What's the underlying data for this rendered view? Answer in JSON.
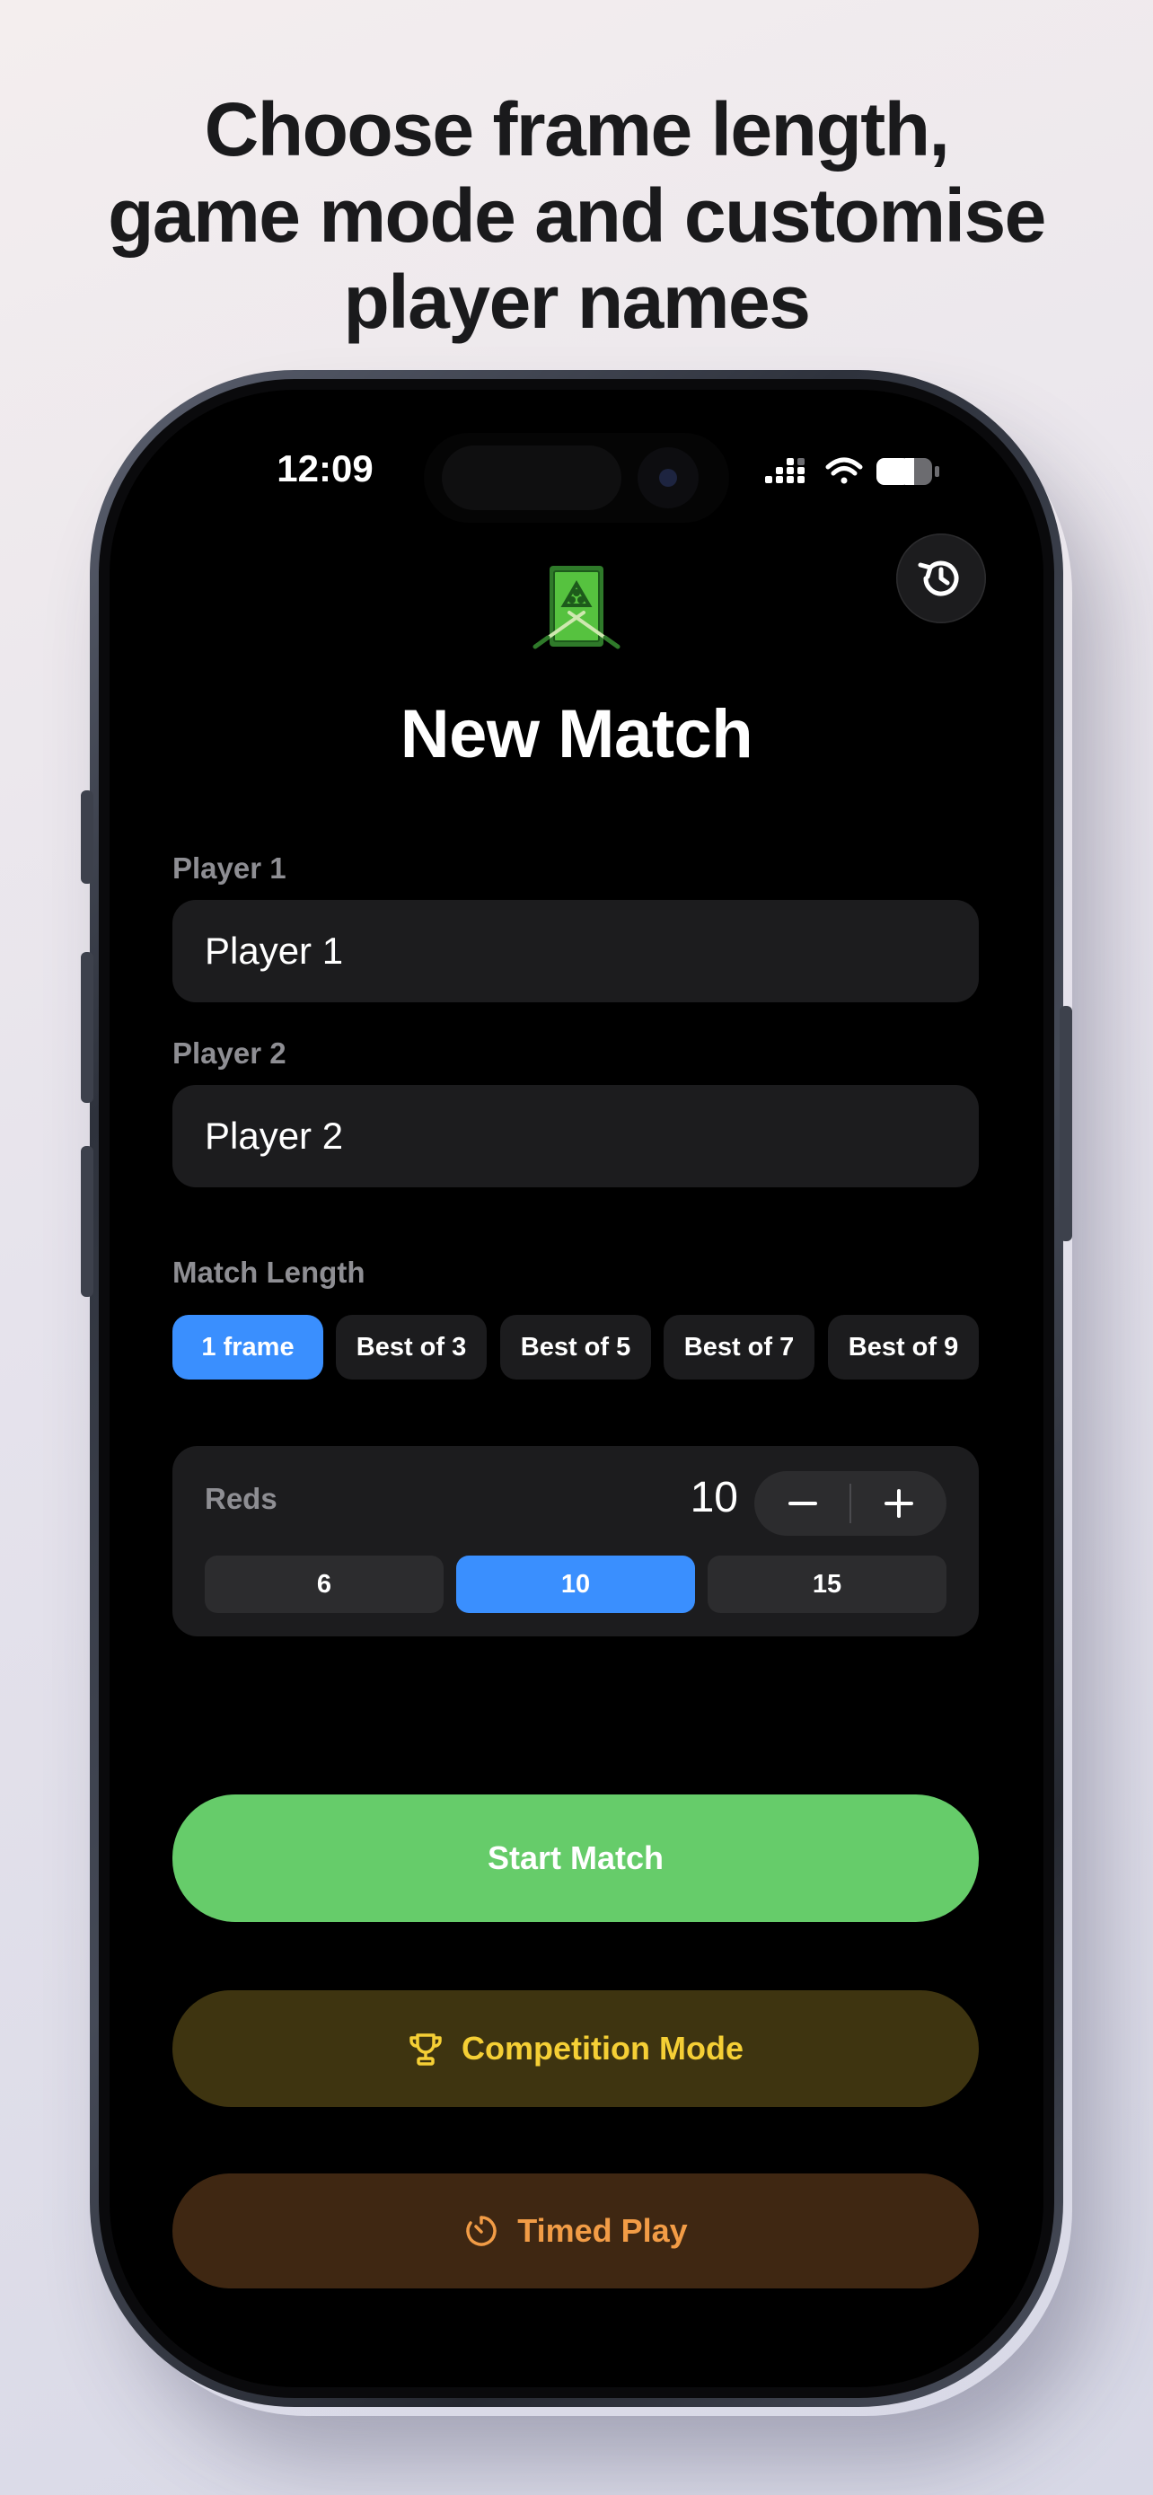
{
  "headline": {
    "lines": [
      "Choose frame length,",
      "game mode and customise",
      "player names"
    ]
  },
  "status_bar": {
    "time": "12:09",
    "icons": [
      "cellular-icon",
      "wifi-icon",
      "battery-icon"
    ]
  },
  "header": {
    "title": "New Match",
    "history_icon": "history-icon",
    "logo_icon": "snooker-table-icon"
  },
  "player1": {
    "label": "Player 1",
    "value": "Player 1"
  },
  "player2": {
    "label": "Player 2",
    "value": "Player 2"
  },
  "match_length": {
    "label": "Match Length",
    "options": [
      "1 frame",
      "Best of 3",
      "Best of 5",
      "Best of 7",
      "Best of 9"
    ],
    "selected": "1 frame"
  },
  "reds": {
    "label": "Reds",
    "value": "10",
    "options": [
      "6",
      "10",
      "15"
    ],
    "selected": "10"
  },
  "buttons": {
    "start": "Start Match",
    "competition": "Competition Mode",
    "competition_icon": "trophy-icon",
    "timed": "Timed Play",
    "timed_icon": "timer-icon"
  },
  "colors": {
    "accent_blue": "#3a8ffe",
    "start_green": "#66cc6a",
    "competition_yellow": "#f5cf35",
    "timed_orange": "#f29c46"
  }
}
